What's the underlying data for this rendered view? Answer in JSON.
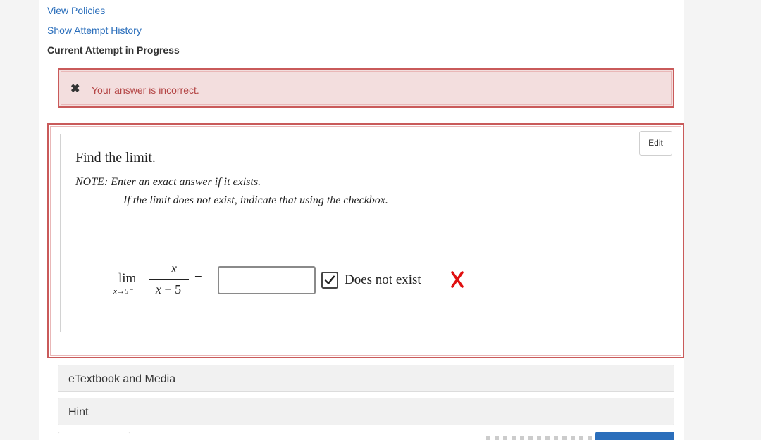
{
  "nav": {
    "view_policies": "View Policies",
    "show_attempt_history": "Show Attempt History",
    "current_attempt": "Current Attempt in Progress"
  },
  "alert": {
    "icon": "close-x-icon",
    "message": "Your answer is incorrect.",
    "color": "#b44545",
    "background": "#f3dede"
  },
  "question": {
    "edit_label": "Edit",
    "title": "Find the limit.",
    "note_line1": "NOTE: Enter an exact answer if it exists.",
    "note_line2": "If the limit does not exist, indicate that using the checkbox.",
    "lim_word": "lim",
    "lim_subscript": "x→5⁻",
    "numerator": "x",
    "denominator_var": "x",
    "denominator_rest": " − 5",
    "equals": "=",
    "answer_value": "",
    "checkbox_checked": true,
    "checkbox_label": "Does not exist",
    "result_icon": "incorrect-x-icon",
    "result_color": "#e01010"
  },
  "sections": {
    "etextbook": "eTextbook and Media",
    "hint": "Hint"
  },
  "colors": {
    "link": "#2a6ebb",
    "error_border": "#c95a5a",
    "primary_button": "#2a6ebb"
  }
}
